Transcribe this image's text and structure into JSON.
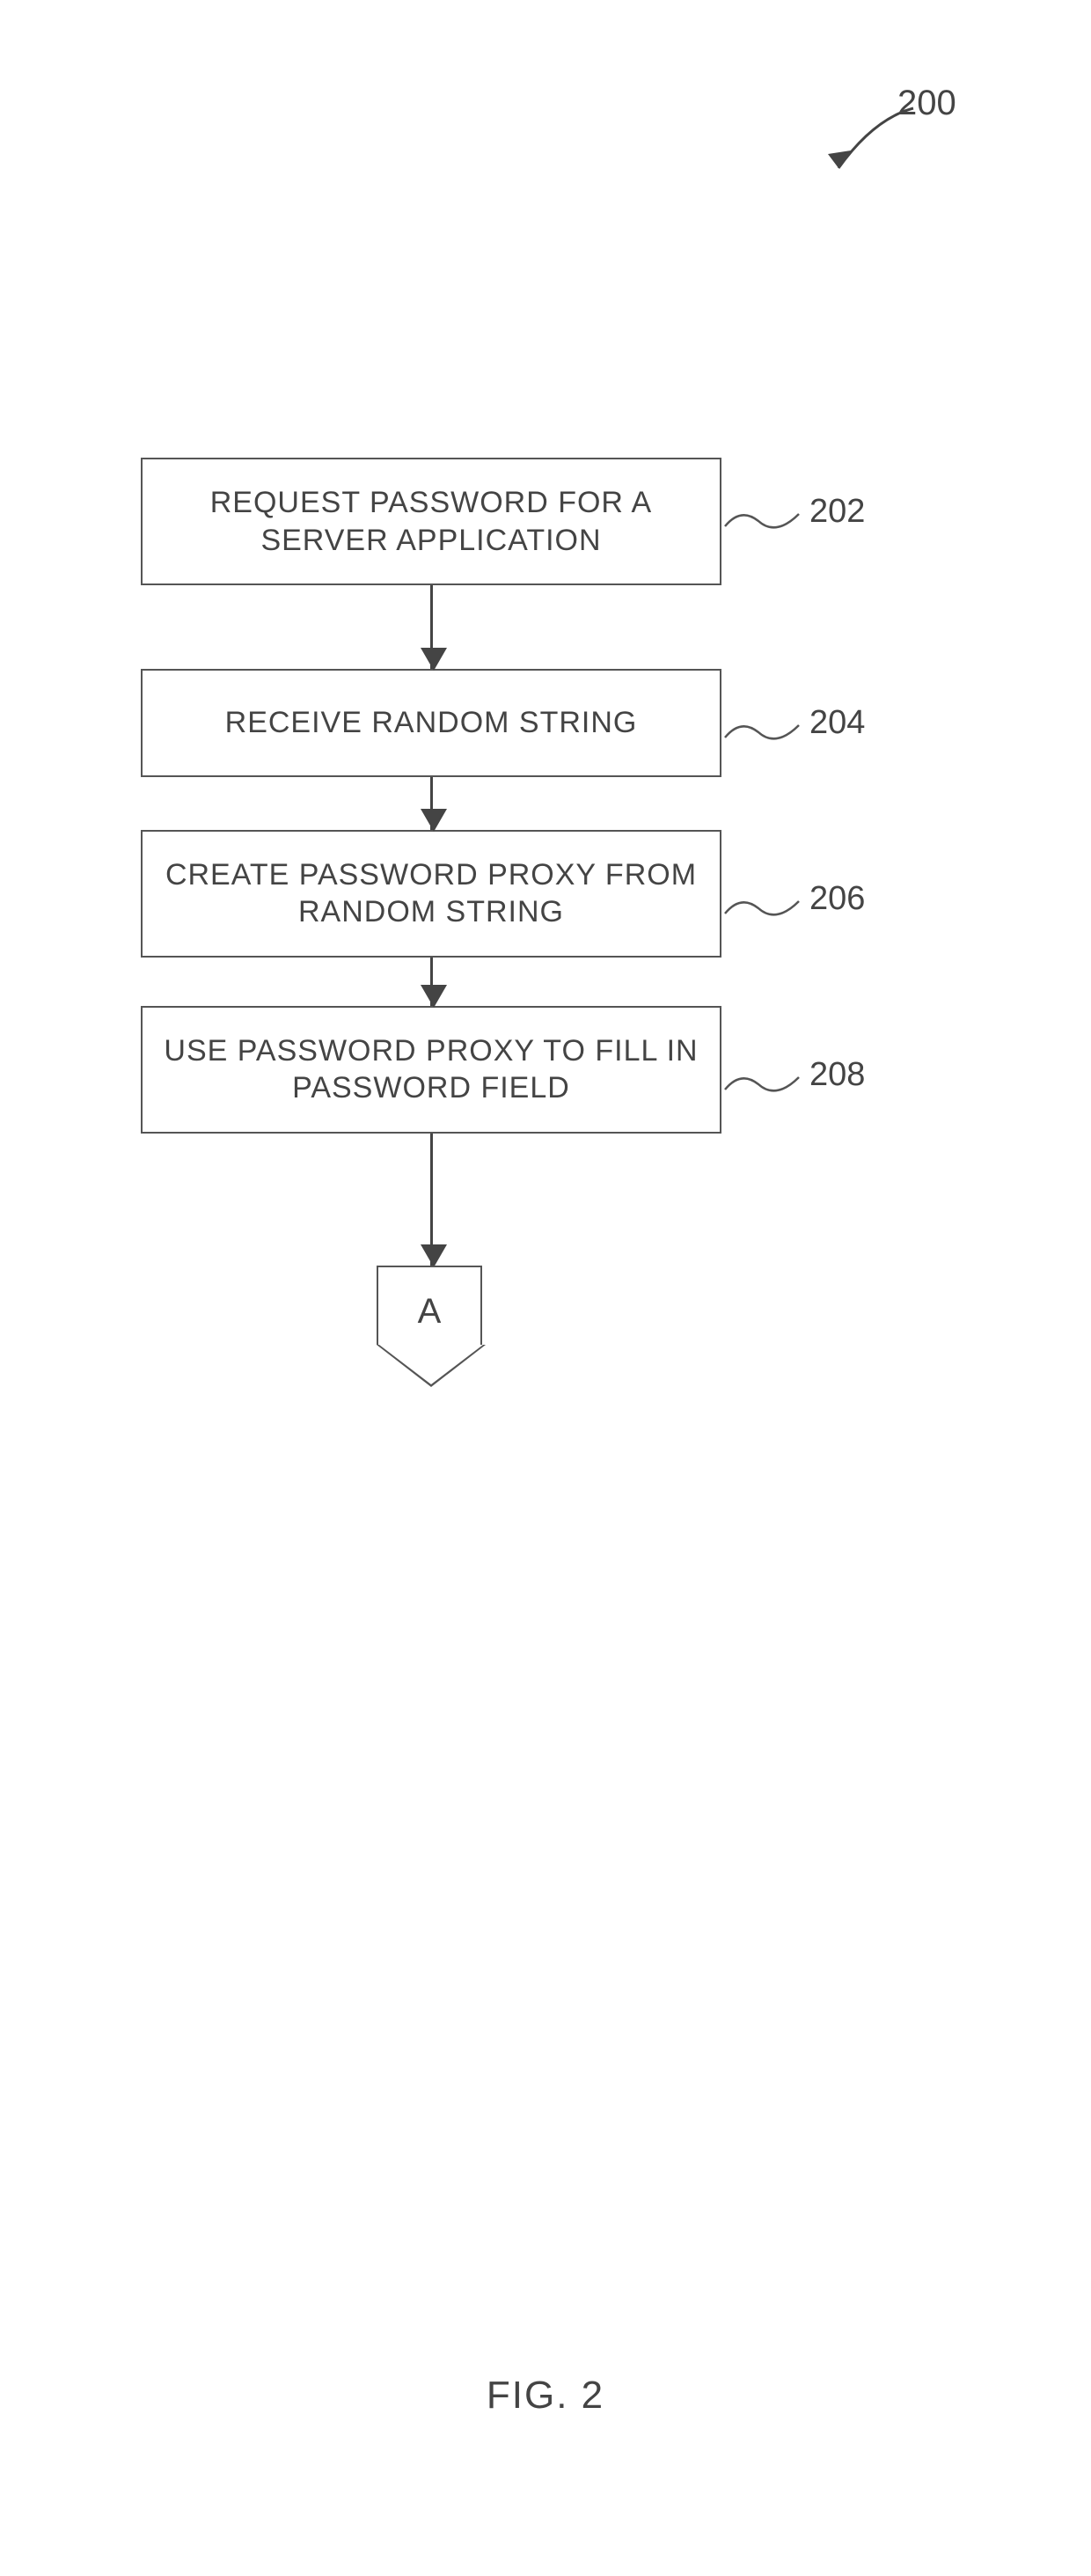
{
  "figure": {
    "reference_number": "200",
    "caption": "FIG. 2",
    "connector_label": "A",
    "steps": [
      {
        "id": "202",
        "text": "REQUEST PASSWORD FOR A SERVER APPLICATION"
      },
      {
        "id": "204",
        "text": "RECEIVE RANDOM STRING"
      },
      {
        "id": "206",
        "text": "CREATE PASSWORD PROXY FROM RANDOM STRING"
      },
      {
        "id": "208",
        "text": "USE PASSWORD PROXY TO FILL IN PASSWORD FIELD"
      }
    ]
  }
}
